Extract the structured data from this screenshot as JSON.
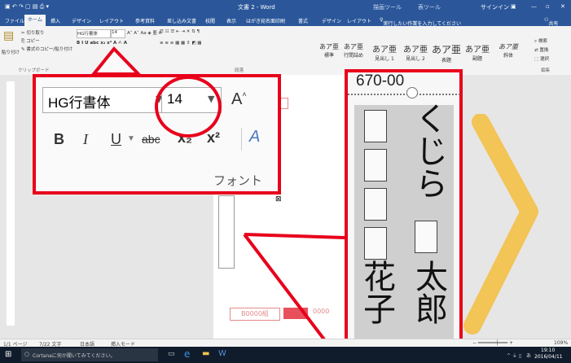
{
  "app": {
    "window_title": "文書 2 - Word",
    "context_tab_1": "描画ツール",
    "context_tab_2": "表ツール",
    "user_name": "サインイン"
  },
  "ribbon_tabs": [
    {
      "label": "ファイル"
    },
    {
      "label": "ホーム"
    },
    {
      "label": "挿入"
    },
    {
      "label": "デザイン"
    },
    {
      "label": "レイアウト"
    },
    {
      "label": "参考資料"
    },
    {
      "label": "差し込み文書"
    },
    {
      "label": "校閲"
    },
    {
      "label": "表示"
    },
    {
      "label": "はがき宛名面印刷"
    },
    {
      "label": "書式"
    },
    {
      "label": "デザイン"
    },
    {
      "label": "レイアウト"
    }
  ],
  "tell_me": "実行したい作業を入力してください",
  "share": "共有",
  "clipboard": {
    "cut": "切り取り",
    "copy": "コピー",
    "paste": "貼り付け",
    "format_painter": "書式のコピー/貼り付け",
    "group": "クリップボード"
  },
  "font_small": {
    "name": "HG行書体",
    "size": "14",
    "group": "フォント"
  },
  "paragraph_group": "段落",
  "styles": [
    {
      "sample": "あア亜",
      "name": "標準"
    },
    {
      "sample": "あア亜",
      "name": "行間詰め"
    },
    {
      "sample": "あア亜",
      "name": "見出し 1"
    },
    {
      "sample": "あア亜",
      "name": "見出し 2"
    },
    {
      "sample": "あア亜",
      "name": "表題"
    },
    {
      "sample": "あア亜",
      "name": "副題"
    },
    {
      "sample": "あア亜",
      "name": "斜体"
    }
  ],
  "editing": {
    "find": "検索",
    "replace": "置換",
    "select": "選択",
    "group": "編集"
  },
  "zoom_callout_font": {
    "font_name": "HG行書体",
    "font_size": "14",
    "group_label": "フォント",
    "bold": "B",
    "italic": "I",
    "underline": "U",
    "strike": "abc",
    "subscript": "x₂",
    "superscript": "x²",
    "grow": "A"
  },
  "postcard": {
    "postal_code": "670-00",
    "name_given": "くじら",
    "name_family": "太郎",
    "name_second": "花子",
    "honorific_mark": "ㄊ",
    "code_label": "B0000組",
    "code_label2": "0000"
  },
  "status_bar": {
    "page": "1/1 ページ",
    "words": "7/22 文字",
    "language": "日本語",
    "mode": "挿入モード",
    "zoom": "109%"
  },
  "taskbar": {
    "search": "Cortanaに何か聞いてみてください。",
    "time": "19:10",
    "date": "2016/04/11",
    "ime": "あ"
  }
}
